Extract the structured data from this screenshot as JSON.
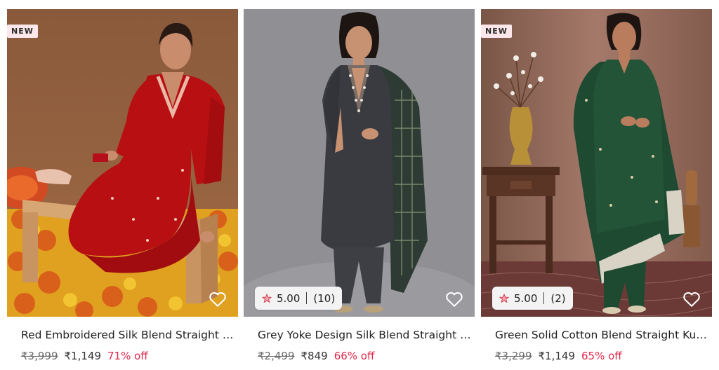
{
  "colors": {
    "accent": "#e0294a",
    "badge_bg": "#fde7ea",
    "rating_bg": "#f3f3f3"
  },
  "products": [
    {
      "badge": "NEW",
      "title": "Red Embroidered Silk Blend Straight Kurta With Trousers & Dupatta",
      "mrp": "₹3,999",
      "price": "₹1,149",
      "discount": "71% off",
      "wishlist_icon": "heart-outline-icon"
    },
    {
      "rating": "5.00",
      "rating_count": "(10)",
      "rating_icon": "star-icon",
      "title": "Grey Yoke Design Silk Blend Straight Kurta With Trousers & Dupatta",
      "mrp": "₹2,499",
      "price": "₹849",
      "discount": "66% off",
      "wishlist_icon": "heart-outline-icon"
    },
    {
      "badge": "NEW",
      "rating": "5.00",
      "rating_count": "(2)",
      "rating_icon": "star-icon",
      "title": "Green Solid Cotton Blend Straight Kurta With Trousers & Dupatta",
      "mrp": "₹3,299",
      "price": "₹1,149",
      "discount": "65% off",
      "wishlist_icon": "heart-outline-icon"
    }
  ]
}
